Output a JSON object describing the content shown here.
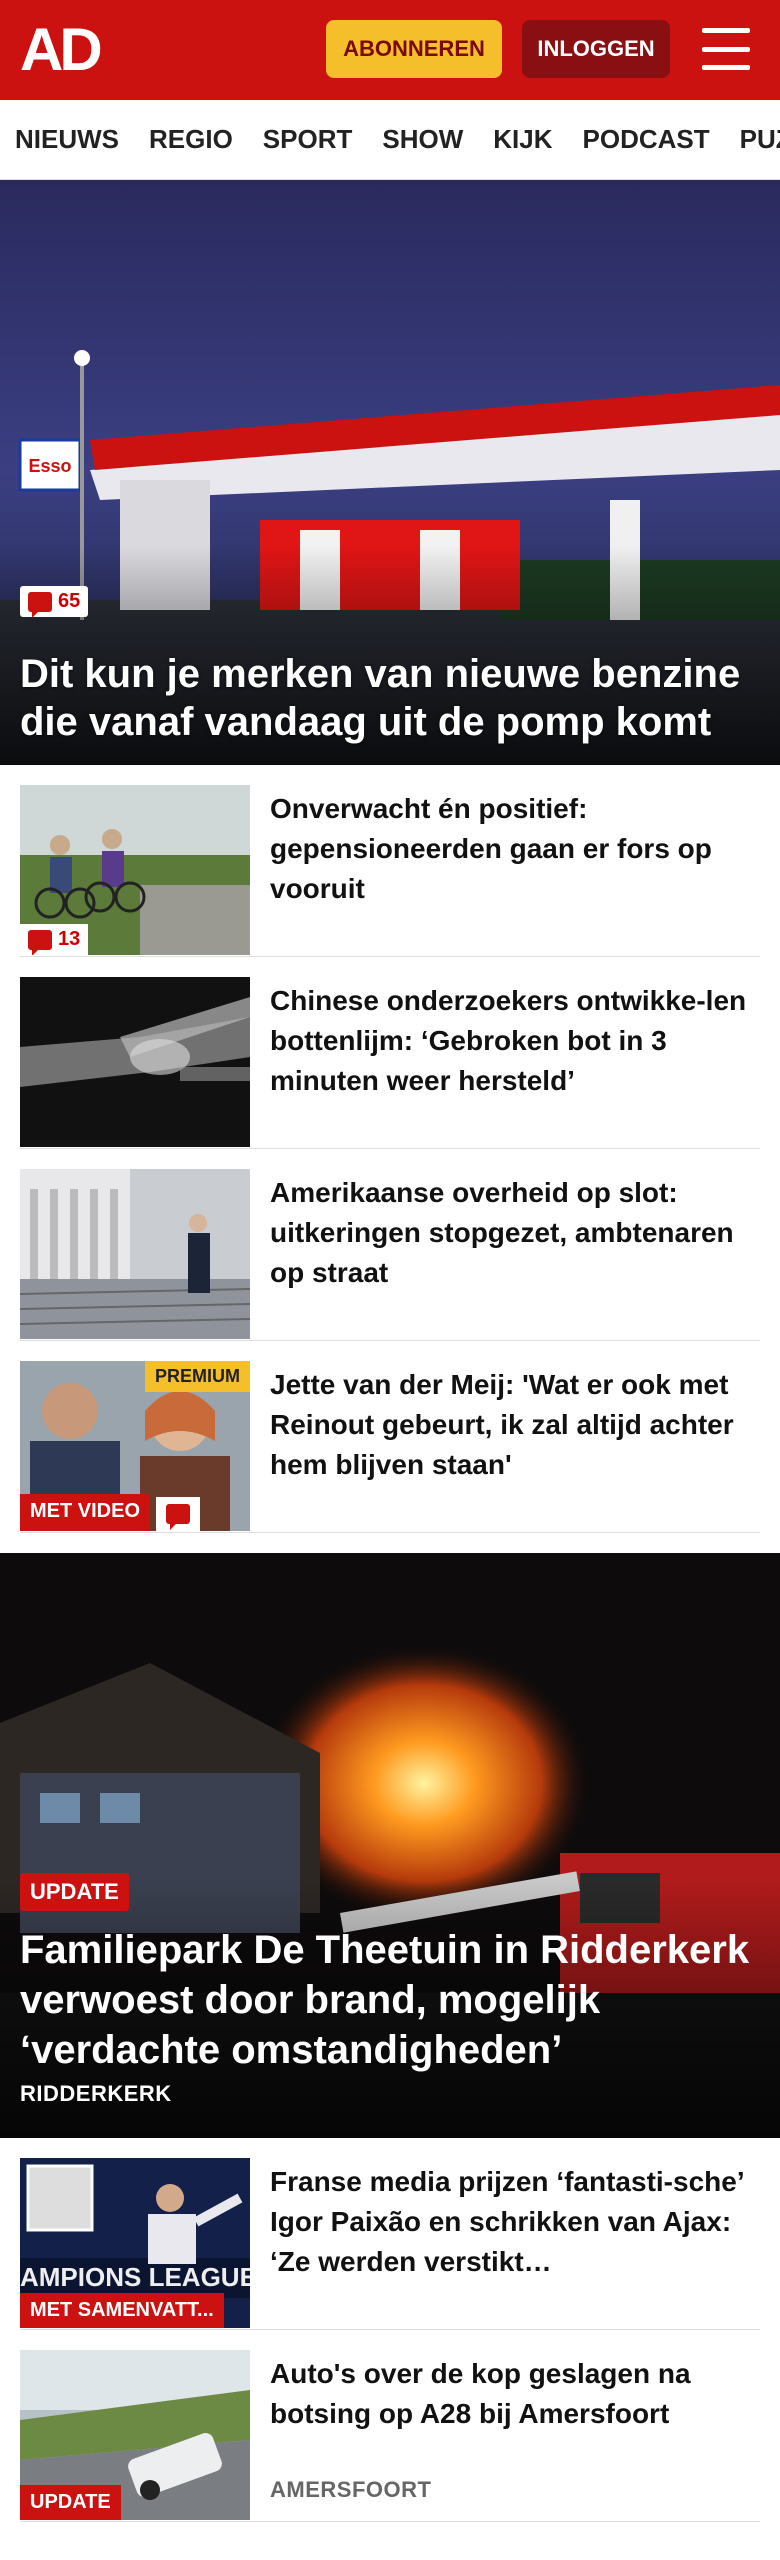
{
  "header": {
    "logo": "AD",
    "subscribe_label": "ABONNEREN",
    "login_label": "INLOGGEN"
  },
  "nav": [
    "NIEUWS",
    "REGIO",
    "SPORT",
    "SHOW",
    "KIJK",
    "PODCAST",
    "PUZZ"
  ],
  "hero": {
    "comments": "65",
    "title": "Dit kun je merken van nieuwe benzine die vanaf vandaag uit de pomp komt"
  },
  "articles": [
    {
      "title": "Onverwacht én positief: gepensioneerden gaan er fors op vooruit",
      "comments": "13"
    },
    {
      "title": "Chinese onderzoekers ontwikke-len bottenlijm: ‘Gebroken bot in 3 minuten weer hersteld’"
    },
    {
      "title": "Amerikaanse overheid op slot: uitkeringen stopgezet, ambtenaren op straat"
    },
    {
      "title": "Jette van der Meij: 'Wat er ook met Reinout gebeurt, ik zal altijd achter hem blijven staan'",
      "premium_label": "PREMIUM",
      "video_label": "MET VIDEO"
    }
  ],
  "hero2": {
    "label": "UPDATE",
    "title": "Familiepark De Theetuin in Ridderkerk verwoest door brand, mogelijk ‘verdachte omstandigheden’",
    "location": "RIDDERKERK"
  },
  "articles2": [
    {
      "title": "Franse media prijzen ‘fantasti-sche’ Igor Paixão en schrikken van Ajax: ‘Ze werden verstikt…",
      "label": "MET SAMENVATT..."
    },
    {
      "title": "Auto's over de kop geslagen na botsing op A28 bij Amersfoort",
      "label": "UPDATE",
      "location": "AMERSFOORT"
    }
  ],
  "colors": {
    "brand": "#cc1111",
    "accent": "#f5bf2b",
    "dark_red": "#8a0f12"
  },
  "icons": [
    "hamburger-menu-icon",
    "comment-icon"
  ]
}
